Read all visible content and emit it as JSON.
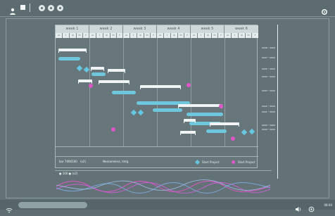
{
  "toolbar": {
    "user_icon": "user-icon",
    "square_icon": "square-icon",
    "round_buttons": [
      "circle-button-1",
      "circle-button-2",
      "circle-button-3"
    ],
    "settings_icon": "gear-icon"
  },
  "gantt": {
    "weeks": [
      "week 1",
      "week 2",
      "week 3",
      "week 4",
      "week 5",
      "week 6"
    ],
    "day_labels": [
      "M",
      "T",
      "W",
      "Th",
      "F"
    ],
    "footer_left_1": "bar 7000100",
    "footer_left_2": "(x2)",
    "footer_mid": "Nessameina, tintg",
    "legend_1": "Start Project",
    "legend_2": "Start Project"
  },
  "chart": {
    "label": "● 100 ● (x2)"
  },
  "scale": {
    "labels": [
      "0008 ─ 0000",
      "0007 ─ 0000",
      "0005 ─ 0000",
      "0004 ─ 0000",
      "0003 ─ 0000",
      "0002 ─ 0000",
      "0001 ─ 0000",
      "0000 ─ 0000",
      "0000 ─ 0000",
      "0000 ─ 0000",
      "0000 ─ 0000"
    ]
  },
  "status": {
    "time": "08:00"
  }
}
